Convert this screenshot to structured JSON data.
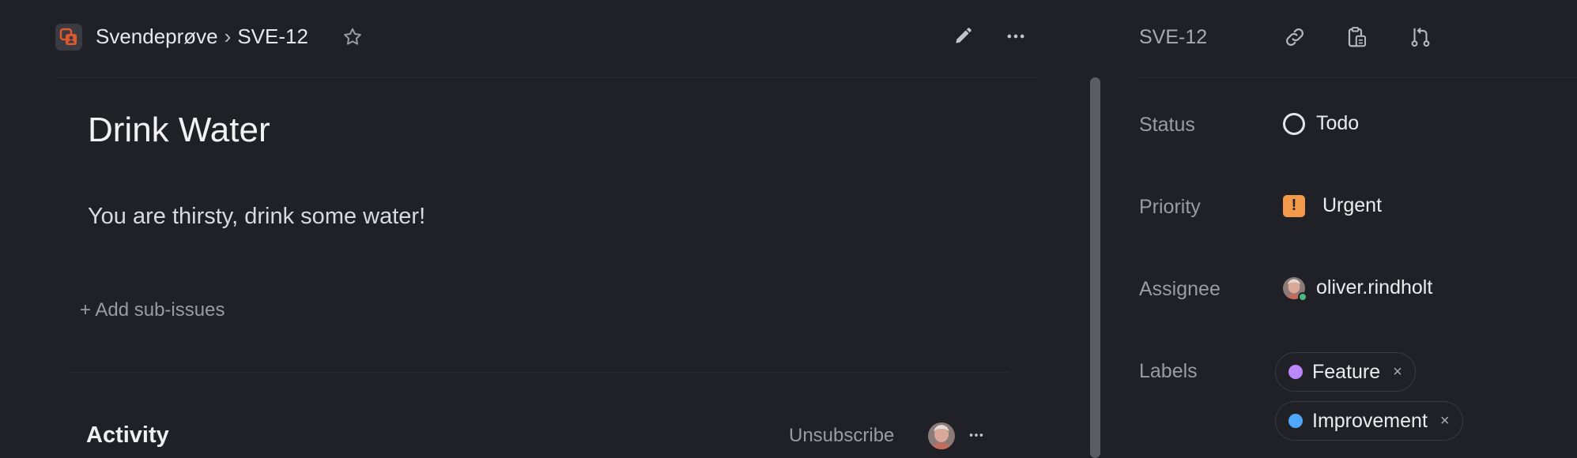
{
  "breadcrumb": {
    "team": "Svendeprøve",
    "separator": "›",
    "issue_id": "SVE-12"
  },
  "issue": {
    "title": "Drink Water",
    "description": "You are thirsty, drink some water!",
    "add_sub_issues": "+ Add sub-issues"
  },
  "activity": {
    "title": "Activity",
    "unsubscribe": "Unsubscribe"
  },
  "sidebar": {
    "issue_id": "SVE-12",
    "status": {
      "label": "Status",
      "value": "Todo"
    },
    "priority": {
      "label": "Priority",
      "value": "Urgent",
      "icon_text": "!"
    },
    "assignee": {
      "label": "Assignee",
      "value": "oliver.rindholt"
    },
    "labels": {
      "label": "Labels",
      "items": [
        {
          "name": "Feature",
          "color": "#bb87fc"
        },
        {
          "name": "Improvement",
          "color": "#4ea7fc"
        }
      ],
      "remove_glyph": "×"
    }
  },
  "colors": {
    "background": "#202126",
    "accent_orange": "#f2994a",
    "team_icon": "#e2572c",
    "online": "#4cb782"
  },
  "icons": {
    "team": "team-icon",
    "star": "star-icon",
    "edit": "pencil-icon",
    "more": "more-horizontal-icon",
    "link": "link-icon",
    "copy": "clipboard-icon",
    "branch": "git-branch-icon"
  }
}
